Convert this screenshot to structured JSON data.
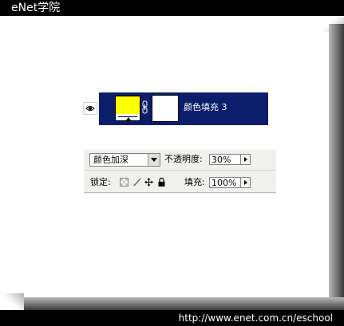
{
  "header": {
    "brand": "eNet学院"
  },
  "footer": {
    "url": "http://www.enet.com.cn/eschool"
  },
  "layer": {
    "name": "颜色填充 3",
    "fill_color": "#ffff00",
    "row_color": "#0c1e6b",
    "visible": true
  },
  "options": {
    "blend_mode": "颜色加深",
    "opacity_label": "不透明度:",
    "opacity_value": "30%",
    "lock_label": "锁定:",
    "fill_label": "填充:",
    "fill_value": "100%"
  },
  "icons": {
    "visibility": "eye-icon",
    "link": "chain-link-icon",
    "lock_transparent": "lock-transparent-pixels-icon",
    "lock_paint": "brush-icon",
    "lock_position": "move-icon",
    "lock_all": "padlock-icon"
  }
}
